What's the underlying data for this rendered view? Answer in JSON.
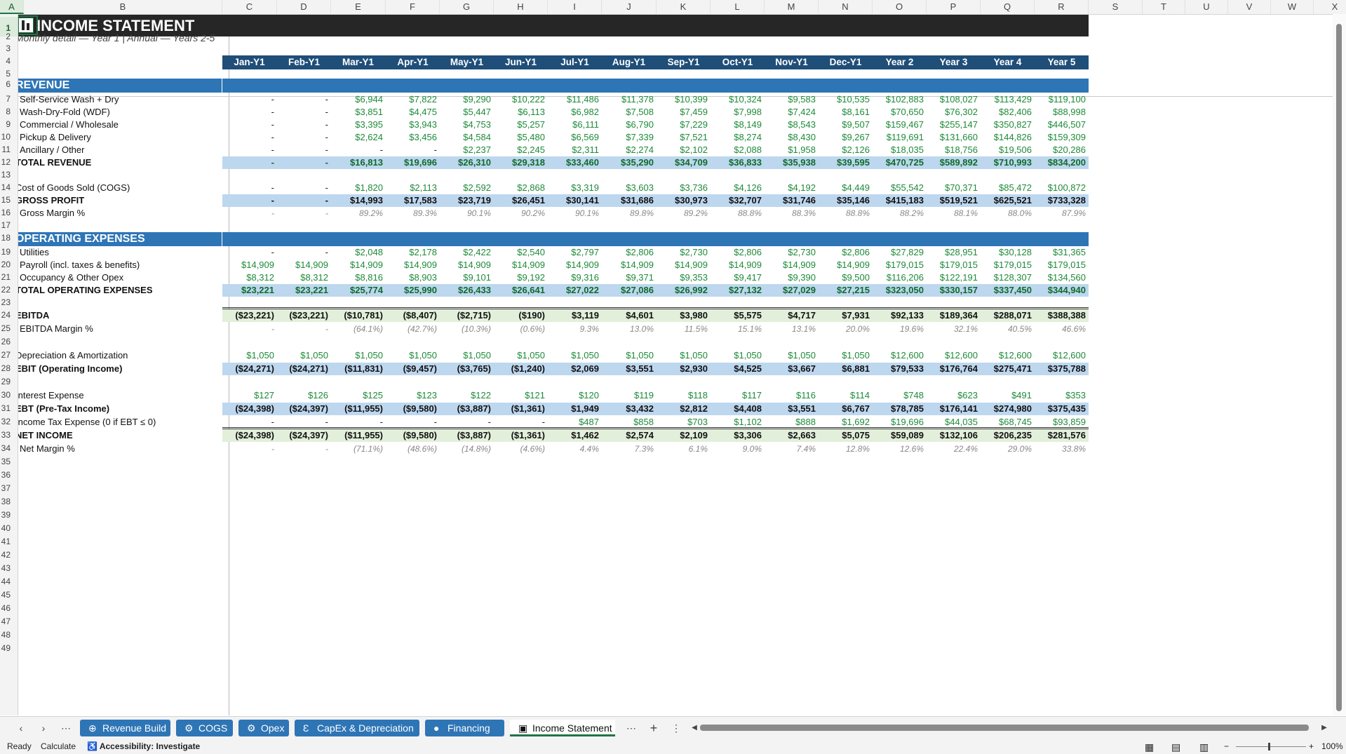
{
  "columns": [
    "A",
    "B",
    "C",
    "D",
    "E",
    "F",
    "G",
    "H",
    "I",
    "J",
    "K",
    "L",
    "M",
    "N",
    "O",
    "P",
    "Q",
    "R",
    "S",
    "T",
    "U",
    "V",
    "W",
    "X"
  ],
  "selected_column": "A",
  "selected_row": "1",
  "row_numbers": [
    "1",
    "2",
    "3",
    "4",
    "5",
    "6",
    "7",
    "8",
    "9",
    "10",
    "11",
    "12",
    "13",
    "14",
    "15",
    "16",
    "17",
    "18",
    "19",
    "20",
    "21",
    "22",
    "23",
    "24",
    "25",
    "26",
    "27",
    "28",
    "29",
    "30",
    "31",
    "32",
    "33",
    "34",
    "35",
    "36",
    "37",
    "38",
    "39",
    "40",
    "41",
    "42",
    "43",
    "44",
    "45",
    "46",
    "47",
    "48",
    "49"
  ],
  "title": "INCOME STATEMENT",
  "subtitle": "Monthly detail — Year 1  |  Annual — Years 2-5",
  "periods": [
    "Jan-Y1",
    "Feb-Y1",
    "Mar-Y1",
    "Apr-Y1",
    "May-Y1",
    "Jun-Y1",
    "Jul-Y1",
    "Aug-Y1",
    "Sep-Y1",
    "Oct-Y1",
    "Nov-Y1",
    "Dec-Y1",
    "Year 2",
    "Year 3",
    "Year 4",
    "Year 5"
  ],
  "rows": [
    {
      "row": 6,
      "type": "section",
      "label": "REVENUE"
    },
    {
      "row": 7,
      "type": "line",
      "label": "Self-Service Wash + Dry",
      "values": [
        "-",
        "-",
        "$6,944",
        "$7,822",
        "$9,290",
        "$10,222",
        "$11,486",
        "$11,378",
        "$10,399",
        "$10,324",
        "$9,583",
        "$10,535",
        "$102,883",
        "$108,027",
        "$113,429",
        "$119,100"
      ]
    },
    {
      "row": 8,
      "type": "line",
      "label": "Wash-Dry-Fold (WDF)",
      "values": [
        "-",
        "-",
        "$3,851",
        "$4,475",
        "$5,447",
        "$6,113",
        "$6,982",
        "$7,508",
        "$7,459",
        "$7,998",
        "$7,424",
        "$8,161",
        "$70,650",
        "$76,302",
        "$82,406",
        "$88,998"
      ]
    },
    {
      "row": 9,
      "type": "line",
      "label": "Commercial / Wholesale",
      "values": [
        "-",
        "-",
        "$3,395",
        "$3,943",
        "$4,753",
        "$5,257",
        "$6,111",
        "$6,790",
        "$7,229",
        "$8,149",
        "$8,543",
        "$9,507",
        "$159,467",
        "$255,147",
        "$350,827",
        "$446,507"
      ]
    },
    {
      "row": 10,
      "type": "line",
      "label": "Pickup & Delivery",
      "values": [
        "-",
        "-",
        "$2,624",
        "$3,456",
        "$4,584",
        "$5,480",
        "$6,569",
        "$7,339",
        "$7,521",
        "$8,274",
        "$8,430",
        "$9,267",
        "$119,691",
        "$131,660",
        "$144,826",
        "$159,309"
      ]
    },
    {
      "row": 11,
      "type": "line",
      "label": "Ancillary / Other",
      "values": [
        "-",
        "-",
        "-",
        "-",
        "$2,237",
        "$2,245",
        "$2,311",
        "$2,274",
        "$2,102",
        "$2,088",
        "$1,958",
        "$2,126",
        "$18,035",
        "$18,756",
        "$19,506",
        "$20,286"
      ]
    },
    {
      "row": 12,
      "type": "total_green",
      "label": "TOTAL REVENUE",
      "values": [
        "-",
        "-",
        "$16,813",
        "$19,696",
        "$26,310",
        "$29,318",
        "$33,460",
        "$35,290",
        "$34,709",
        "$36,833",
        "$35,938",
        "$39,595",
        "$470,725",
        "$589,892",
        "$710,993",
        "$834,200"
      ]
    },
    {
      "row": 14,
      "type": "plain_green",
      "label": "Cost of Goods Sold (COGS)",
      "values": [
        "-",
        "-",
        "$1,820",
        "$2,113",
        "$2,592",
        "$2,868",
        "$3,319",
        "$3,603",
        "$3,736",
        "$4,126",
        "$4,192",
        "$4,449",
        "$55,542",
        "$70,371",
        "$85,472",
        "$100,872"
      ]
    },
    {
      "row": 15,
      "type": "total_black",
      "label": "GROSS PROFIT",
      "values": [
        "-",
        "-",
        "$14,993",
        "$17,583",
        "$23,719",
        "$26,451",
        "$30,141",
        "$31,686",
        "$30,973",
        "$32,707",
        "$31,746",
        "$35,146",
        "$415,183",
        "$519,521",
        "$625,521",
        "$733,328"
      ]
    },
    {
      "row": 16,
      "type": "pct",
      "label": "Gross Margin %",
      "values": [
        "-",
        "-",
        "89.2%",
        "89.3%",
        "90.1%",
        "90.2%",
        "90.1%",
        "89.8%",
        "89.2%",
        "88.8%",
        "88.3%",
        "88.8%",
        "88.2%",
        "88.1%",
        "88.0%",
        "87.9%"
      ]
    },
    {
      "row": 18,
      "type": "section",
      "label": "OPERATING EXPENSES"
    },
    {
      "row": 19,
      "type": "line",
      "label": "Utilities",
      "values": [
        "-",
        "-",
        "$2,048",
        "$2,178",
        "$2,422",
        "$2,540",
        "$2,797",
        "$2,806",
        "$2,730",
        "$2,806",
        "$2,730",
        "$2,806",
        "$27,829",
        "$28,951",
        "$30,128",
        "$31,365"
      ]
    },
    {
      "row": 20,
      "type": "line",
      "label": "Payroll (incl. taxes & benefits)",
      "values": [
        "$14,909",
        "$14,909",
        "$14,909",
        "$14,909",
        "$14,909",
        "$14,909",
        "$14,909",
        "$14,909",
        "$14,909",
        "$14,909",
        "$14,909",
        "$14,909",
        "$179,015",
        "$179,015",
        "$179,015",
        "$179,015"
      ]
    },
    {
      "row": 21,
      "type": "line",
      "label": "Occupancy & Other Opex",
      "values": [
        "$8,312",
        "$8,312",
        "$8,816",
        "$8,903",
        "$9,101",
        "$9,192",
        "$9,316",
        "$9,371",
        "$9,353",
        "$9,417",
        "$9,390",
        "$9,500",
        "$116,206",
        "$122,191",
        "$128,307",
        "$134,560"
      ]
    },
    {
      "row": 22,
      "type": "total_green",
      "label": "TOTAL OPERATING EXPENSES",
      "values": [
        "$23,221",
        "$23,221",
        "$25,774",
        "$25,990",
        "$26,433",
        "$26,641",
        "$27,022",
        "$27,086",
        "$26,992",
        "$27,132",
        "$27,029",
        "$27,215",
        "$323,050",
        "$330,157",
        "$337,450",
        "$344,940"
      ]
    },
    {
      "row": 24,
      "type": "ebitda",
      "label": "EBITDA",
      "values": [
        "($23,221)",
        "($23,221)",
        "($10,781)",
        "($8,407)",
        "($2,715)",
        "($190)",
        "$3,119",
        "$4,601",
        "$3,980",
        "$5,575",
        "$4,717",
        "$7,931",
        "$92,133",
        "$189,364",
        "$288,071",
        "$388,388"
      ]
    },
    {
      "row": 25,
      "type": "pct",
      "label": "EBITDA Margin %",
      "values": [
        "-",
        "-",
        "(64.1%)",
        "(42.7%)",
        "(10.3%)",
        "(0.6%)",
        "9.3%",
        "13.0%",
        "11.5%",
        "15.1%",
        "13.1%",
        "20.0%",
        "19.6%",
        "32.1%",
        "40.5%",
        "46.6%"
      ]
    },
    {
      "row": 27,
      "type": "plain_green",
      "label": "Depreciation & Amortization",
      "values": [
        "$1,050",
        "$1,050",
        "$1,050",
        "$1,050",
        "$1,050",
        "$1,050",
        "$1,050",
        "$1,050",
        "$1,050",
        "$1,050",
        "$1,050",
        "$1,050",
        "$12,600",
        "$12,600",
        "$12,600",
        "$12,600"
      ]
    },
    {
      "row": 28,
      "type": "total_black",
      "label": "EBIT (Operating Income)",
      "values": [
        "($24,271)",
        "($24,271)",
        "($11,831)",
        "($9,457)",
        "($3,765)",
        "($1,240)",
        "$2,069",
        "$3,551",
        "$2,930",
        "$4,525",
        "$3,667",
        "$6,881",
        "$79,533",
        "$176,764",
        "$275,471",
        "$375,788"
      ]
    },
    {
      "row": 30,
      "type": "plain_green",
      "label": "Interest Expense",
      "values": [
        "$127",
        "$126",
        "$125",
        "$123",
        "$122",
        "$121",
        "$120",
        "$119",
        "$118",
        "$117",
        "$116",
        "$114",
        "$748",
        "$623",
        "$491",
        "$353"
      ]
    },
    {
      "row": 31,
      "type": "total_black",
      "label": "EBT (Pre-Tax Income)",
      "values": [
        "($24,398)",
        "($24,397)",
        "($11,955)",
        "($9,580)",
        "($3,887)",
        "($1,361)",
        "$1,949",
        "$3,432",
        "$2,812",
        "$4,408",
        "$3,551",
        "$6,767",
        "$78,785",
        "$176,141",
        "$274,980",
        "$375,435"
      ]
    },
    {
      "row": 32,
      "type": "plain_green",
      "label": "Income Tax Expense  (0 if EBT ≤ 0)",
      "values": [
        "-",
        "-",
        "-",
        "-",
        "-",
        "-",
        "$487",
        "$858",
        "$703",
        "$1,102",
        "$888",
        "$1,692",
        "$19,696",
        "$44,035",
        "$68,745",
        "$93,859"
      ]
    },
    {
      "row": 33,
      "type": "net",
      "label": "NET INCOME",
      "values": [
        "($24,398)",
        "($24,397)",
        "($11,955)",
        "($9,580)",
        "($3,887)",
        "($1,361)",
        "$1,462",
        "$2,574",
        "$2,109",
        "$3,306",
        "$2,663",
        "$5,075",
        "$59,089",
        "$132,106",
        "$206,235",
        "$281,576"
      ]
    },
    {
      "row": 34,
      "type": "pct",
      "label": "Net Margin %",
      "values": [
        "-",
        "-",
        "(71.1%)",
        "(48.6%)",
        "(14.8%)",
        "(4.6%)",
        "4.4%",
        "7.3%",
        "6.1%",
        "9.0%",
        "7.4%",
        "12.8%",
        "12.6%",
        "22.4%",
        "29.0%",
        "33.8%"
      ]
    }
  ],
  "tabs": [
    {
      "label": "Revenue Build",
      "icon": "⊕"
    },
    {
      "label": "COGS",
      "icon": "⚙"
    },
    {
      "label": "Opex",
      "icon": "⚙"
    },
    {
      "label": "CapEx & Depreciation",
      "icon": "Ɛ"
    },
    {
      "label": "Financing",
      "icon": "●"
    },
    {
      "label": "Income Statement",
      "icon": "▣",
      "active": true
    }
  ],
  "status": {
    "ready": "Ready",
    "calculate": "Calculate",
    "accessibility": "Accessibility: Investigate",
    "zoom": "100%"
  },
  "colors": {
    "title_bar": "#262626",
    "header_blue": "#1f4e79",
    "section_blue": "#2e75b6",
    "total_blue": "#bdd7ee",
    "ebitda_green": "#e2efda",
    "value_green": "#1e8a3a"
  }
}
